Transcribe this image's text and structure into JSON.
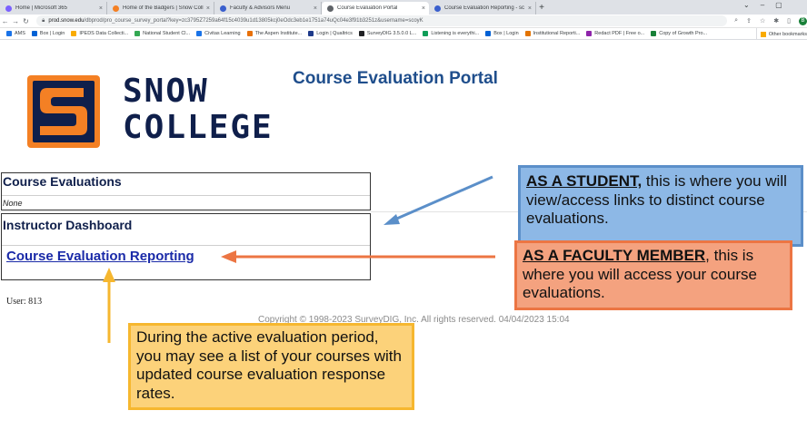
{
  "browser": {
    "tabs": [
      {
        "label": "Home | Microsoft 365",
        "color": "#7b61ff",
        "active": false
      },
      {
        "label": "Home of the Badgers | Snow Coll",
        "color": "#f48024",
        "active": false
      },
      {
        "label": "Faculty & Advisors Menu",
        "color": "#3a5fcd",
        "active": false
      },
      {
        "label": "Course Evaluation Portal",
        "color": "#5f6368",
        "active": true
      },
      {
        "label": "Course Evaluation Reporting - sc",
        "color": "#3a5fcd",
        "active": false
      }
    ],
    "url_host": "prod.snow.edu",
    "url_path": "/dbprod/pro_course_survey_portal?key=zc3795Z7259a64f15c4039u1d13805kcj0eOdc3eb1e1751a74uQc04e3f91b3251z&username=scoyK",
    "bookmarks": [
      {
        "label": "AMS",
        "color": "#1a73e8"
      },
      {
        "label": "Box | Login",
        "color": "#0061d5"
      },
      {
        "label": "IPEDS Data Collecti...",
        "color": "#f9ab00"
      },
      {
        "label": "National Student Cl...",
        "color": "#34a853"
      },
      {
        "label": "Civitas Learning",
        "color": "#1a73e8"
      },
      {
        "label": "The Aspen Institute...",
        "color": "#e8710a"
      },
      {
        "label": "Login | Qualtrics",
        "color": "#1e3a8a"
      },
      {
        "label": "SurveyDIG 3.5.0.0 L...",
        "color": "#202124"
      },
      {
        "label": "Listening is everythi...",
        "color": "#0f9d58"
      },
      {
        "label": "Box | Login",
        "color": "#0061d5"
      },
      {
        "label": "Institutional Reporti...",
        "color": "#e37400"
      },
      {
        "label": "Redact PDF | Free o...",
        "color": "#8e24aa"
      },
      {
        "label": "Copy of Growth Pro...",
        "color": "#188038"
      }
    ],
    "other_bookmarks": "Other bookmarks",
    "profile_initial": "B"
  },
  "logo": {
    "line1": "SNOW",
    "line2": "COLLEGE",
    "brand_orange": "#f48024",
    "brand_navy": "#0f1f4b"
  },
  "page": {
    "title": "Course Evaluation Portal",
    "course_evaluations": {
      "heading": "Course Evaluations",
      "value": "None"
    },
    "instructor_dashboard": {
      "heading": "Instructor Dashboard",
      "link": "Course Evaluation Reporting"
    },
    "user": "User: 813",
    "copyright": "Copyright © 1998-2023 SurveyDIG, Inc. All rights reserved. 04/04/2023 15:04"
  },
  "callouts": {
    "student": {
      "bold": "AS A STUDENT,",
      "rest": " this is where you will view/access links to distinct course evaluations."
    },
    "faculty": {
      "bold": "AS A FACULTY MEMBER",
      "rest": ", this is where you will access your course evaluations."
    },
    "active_period": {
      "text": "During the active evaluation period, you may see a list of your courses with updated course evaluation response rates."
    }
  }
}
